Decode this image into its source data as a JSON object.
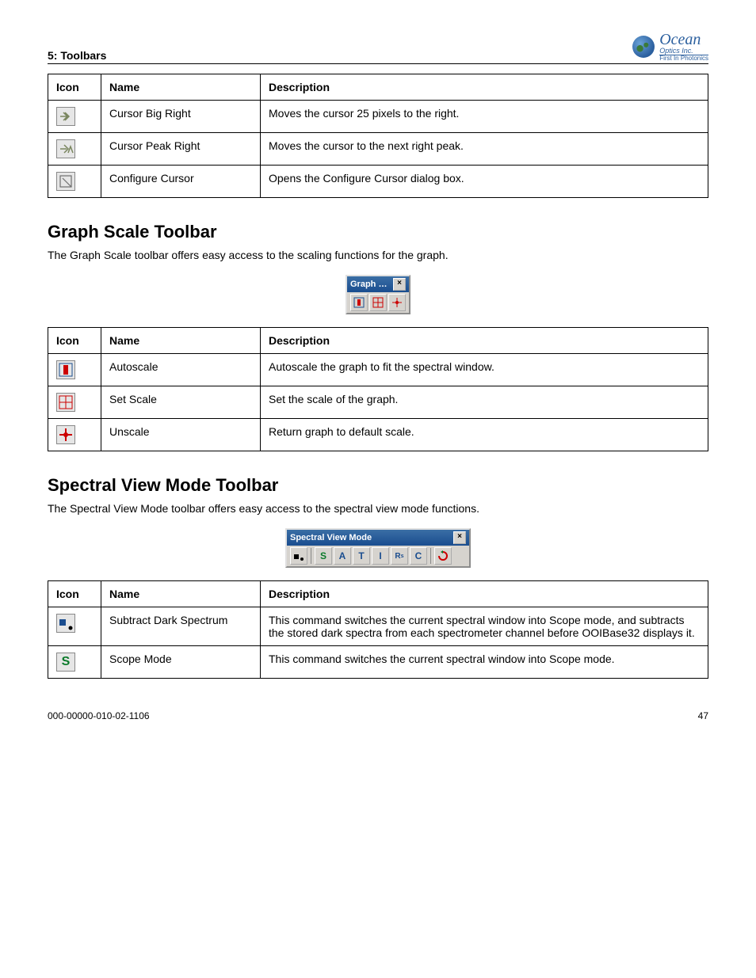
{
  "header": {
    "running_head": "5: Toolbars",
    "logo_line1": "Ocean",
    "logo_line2": "Optics Inc.",
    "logo_line3": "First In Photonics"
  },
  "table1": {
    "headers": [
      "Icon",
      "Name",
      "Description"
    ],
    "rows": [
      {
        "name": "Cursor Big Right",
        "desc": "Moves the cursor 25 pixels to the right."
      },
      {
        "name": "Cursor Peak Right",
        "desc": "Moves the cursor to the next right peak."
      },
      {
        "name": "Configure Cursor",
        "desc": "Opens the Configure Cursor dialog box."
      }
    ]
  },
  "section2": {
    "title": "Graph Scale Toolbar",
    "desc": "The Graph Scale toolbar offers easy access to the scaling functions for the graph.",
    "toolbar_title": "Graph …",
    "table": {
      "headers": [
        "Icon",
        "Name",
        "Description"
      ],
      "rows": [
        {
          "name": "Autoscale",
          "desc": "Autoscale the graph to fit the spectral window."
        },
        {
          "name": "Set Scale",
          "desc": "Set the scale of the graph."
        },
        {
          "name": "Unscale",
          "desc": "Return graph to default scale."
        }
      ]
    }
  },
  "section3": {
    "title": "Spectral View Mode Toolbar",
    "desc": "The Spectral View Mode toolbar offers easy access to the spectral view mode functions.",
    "toolbar_title": "Spectral View Mode",
    "table": {
      "headers": [
        "Icon",
        "Name",
        "Description"
      ],
      "rows": [
        {
          "name": "Subtract Dark Spectrum",
          "desc": "This command switches the current spectral window into Scope mode, and subtracts the stored dark spectra from each spectrometer channel before OOIBase32 displays it."
        },
        {
          "name": "Scope Mode",
          "desc": "This command switches the current spectral window into Scope mode."
        }
      ]
    }
  },
  "footer": {
    "doc_id": "000-00000-010-02-1106",
    "page": "47"
  }
}
